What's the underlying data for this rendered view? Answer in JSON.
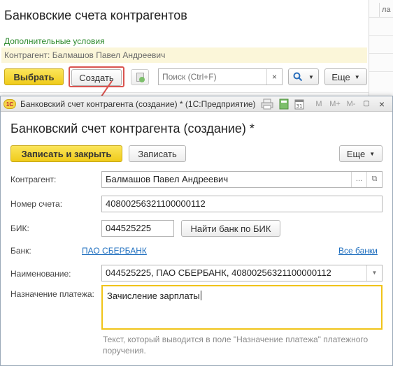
{
  "background_form": {
    "title": "Банковские счета контрагентов",
    "right_tab_fragment": "ла",
    "additional_conditions_link": "Дополнительные условия",
    "contractor_filter": "Контрагент: Балмашов Павел Андреевич",
    "toolbar": {
      "select_label": "Выбрать",
      "create_label": "Создать",
      "search_placeholder": "Поиск (Ctrl+F)",
      "clear_symbol": "×",
      "more_label": "Еще"
    }
  },
  "dialog": {
    "window_title": "Банковский счет контрагента (создание) *  (1С:Предприятие)",
    "logo_text": "1С",
    "titlebar_icons": [
      "M",
      "M+",
      "M-"
    ],
    "header": "Банковский счет контрагента (создание) *",
    "buttons": {
      "save_close_label": "Записать и закрыть",
      "save_label": "Записать",
      "more_label": "Еще"
    },
    "fields": {
      "contractor_label": "Контрагент:",
      "contractor_value": "Балмашов Павел Андреевич",
      "account_label": "Номер счета:",
      "account_value": "40800256321100000112",
      "bik_label": "БИК:",
      "bik_value": "044525225",
      "find_bank_label": "Найти банк по БИК",
      "bank_label": "Банк:",
      "bank_value": "ПАО СБЕРБАНК",
      "all_banks_link": "Все банки",
      "name_label": "Наименование:",
      "name_value": "044525225, ПАО СБЕРБАНК, 40800256321100000112",
      "purpose_label": "Назначение платежа:",
      "purpose_value": "Зачисление зарплаты",
      "purpose_hint": "Текст, который выводится в поле \"Назначение платежа\" платежного поручения."
    }
  },
  "colors": {
    "accent_yellow": "#f0cb1b",
    "link_blue": "#1f6fbf",
    "link_green": "#2d8a2d",
    "highlight_red": "#d9534f"
  }
}
